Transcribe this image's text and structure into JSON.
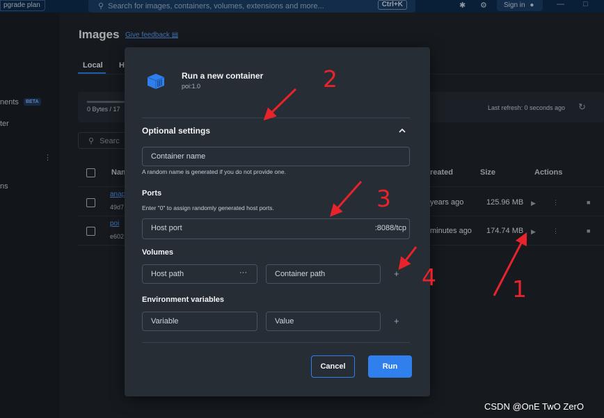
{
  "topbar": {
    "upgrade_label": "pgrade plan",
    "search_placeholder": "Search for images, containers, volumes, extensions and more...",
    "search_shortcut": "Ctrl+K",
    "sign_in_label": "Sign in",
    "icons": [
      "search-icon",
      "bug-icon",
      "gear-icon",
      "user-icon",
      "minimize-icon",
      "maximize-icon"
    ]
  },
  "sidebar": {
    "items": [
      {
        "label": "nents"
      },
      {
        "label": "ter"
      },
      {
        "label": "ns"
      }
    ],
    "beta_badge": "BETA"
  },
  "background": {
    "page_title": "Images",
    "feedback_link": "Give feedback",
    "tabs": [
      {
        "label": "Local"
      },
      {
        "label": "H"
      }
    ],
    "storage_text": "0 Bytes / 17",
    "refresh_text": "Last refresh: 0 seconds ago",
    "search_placeholder": "Searc",
    "columns": {
      "name": "Nam",
      "created": "reated",
      "size": "Size",
      "actions": "Actions"
    },
    "rows": [
      {
        "name": "anap",
        "id": "49d7",
        "created": "years ago",
        "size": "125.96 MB"
      },
      {
        "name": "poi",
        "id": "e602",
        "created": "minutes ago",
        "size": "174.74 MB"
      }
    ]
  },
  "modal": {
    "title": "Run a new container",
    "subtitle": "poi:1.0",
    "optional_settings": "Optional settings",
    "container_name_placeholder": "Container name",
    "container_name_hint": "A random name is generated if you do not provide one.",
    "ports_label": "Ports",
    "ports_hint": "Enter \"0\" to assign randomly generated host ports.",
    "host_port_placeholder": "Host port",
    "host_port_suffix": ":8088/tcp",
    "volumes_label": "Volumes",
    "host_path_placeholder": "Host path",
    "host_path_browse": "···",
    "container_path_placeholder": "Container path",
    "env_label": "Environment variables",
    "variable_placeholder": "Variable",
    "value_placeholder": "Value",
    "cancel_label": "Cancel",
    "run_label": "Run",
    "accent_color": "#2f80ed"
  },
  "annotations": {
    "numbers": [
      "1",
      "2",
      "3",
      "4"
    ],
    "color": "#e8232b",
    "watermark": "CSDN @OnE TwO ZerO"
  }
}
